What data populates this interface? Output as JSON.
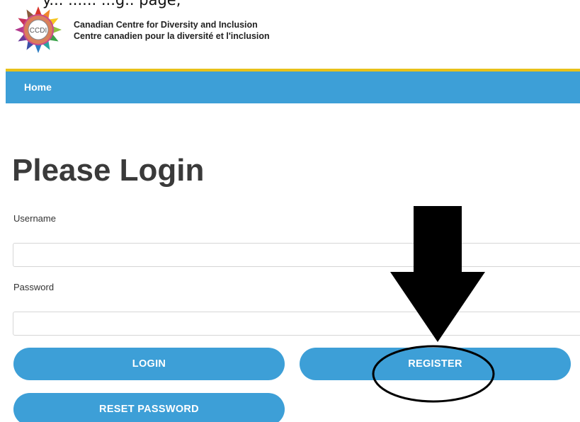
{
  "caption": "y... ...... ...g.. page,",
  "header": {
    "logo_text": "CCDI",
    "org_name_en": "Canadian Centre for Diversity and Inclusion",
    "org_name_fr": "Centre canadien pour la diversité et l'inclusion"
  },
  "nav": {
    "items": [
      {
        "label": "Home"
      }
    ]
  },
  "main": {
    "title": "Please Login",
    "username_label": "Username",
    "username_value": "",
    "password_label": "Password",
    "password_value": "",
    "login_button": "LOGIN",
    "register_button": "REGISTER",
    "reset_button": "RESET PASSWORD"
  },
  "colors": {
    "nav_blue": "#3d9fd7",
    "accent_yellow": "#e8c11a",
    "title_gray": "#3a3a3a"
  },
  "annotation": {
    "arrow_icon": "down-arrow-icon",
    "circle_target": "register-button"
  }
}
